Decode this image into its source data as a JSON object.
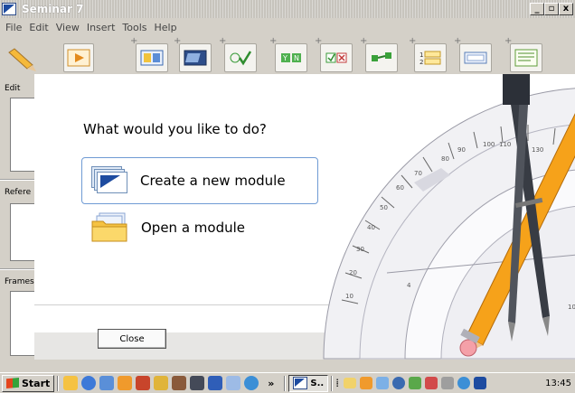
{
  "window": {
    "title": "Seminar 7",
    "controls": [
      "_",
      "▫",
      "x"
    ]
  },
  "menu": [
    "File",
    "Edit",
    "View",
    "Insert",
    "Tools",
    "Help"
  ],
  "panels": {
    "edit": "Edit",
    "reference": "Refere",
    "frames": "Frames"
  },
  "dialog": {
    "question": "What would you like to do?",
    "create_label": "Create a new module",
    "open_label": "Open a module",
    "close_label": "Close"
  },
  "taskbar": {
    "start_label": "Start",
    "overflow": "»",
    "active_task": "S..",
    "clock": "13:45"
  },
  "colors": {
    "selection_border": "#6f9bd4",
    "accent_blue": "#1d4ba0",
    "folder": "#f5c242"
  }
}
